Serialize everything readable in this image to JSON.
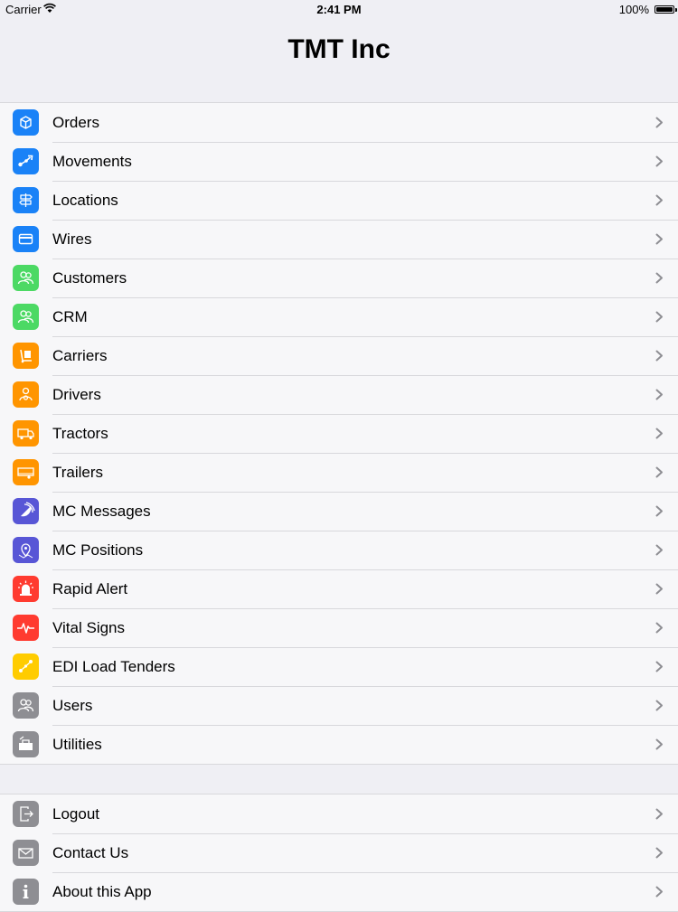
{
  "status": {
    "carrier": "Carrier",
    "time": "2:41 PM",
    "battery": "100%"
  },
  "nav": {
    "title": "TMT Inc"
  },
  "menu": [
    {
      "label": "Orders",
      "icon": "box-icon",
      "color": "#1a82f7"
    },
    {
      "label": "Movements",
      "icon": "route-icon",
      "color": "#1a82f7"
    },
    {
      "label": "Locations",
      "icon": "signpost-icon",
      "color": "#1a82f7"
    },
    {
      "label": "Wires",
      "icon": "card-icon",
      "color": "#1a82f7"
    },
    {
      "label": "Customers",
      "icon": "people-icon",
      "color": "#4cd964"
    },
    {
      "label": "CRM",
      "icon": "people-icon",
      "color": "#4cd964"
    },
    {
      "label": "Carriers",
      "icon": "dolly-icon",
      "color": "#ff9500"
    },
    {
      "label": "Drivers",
      "icon": "driver-icon",
      "color": "#ff9500"
    },
    {
      "label": "Tractors",
      "icon": "truck-icon",
      "color": "#ff9500"
    },
    {
      "label": "Trailers",
      "icon": "trailer-icon",
      "color": "#ff9500"
    },
    {
      "label": "MC Messages",
      "icon": "satellite-icon",
      "color": "#5856d6"
    },
    {
      "label": "MC Positions",
      "icon": "map-pin-icon",
      "color": "#5856d6"
    },
    {
      "label": "Rapid Alert",
      "icon": "alarm-icon",
      "color": "#ff3b30"
    },
    {
      "label": "Vital Signs",
      "icon": "pulse-icon",
      "color": "#ff3b30"
    },
    {
      "label": "EDI Load Tenders",
      "icon": "connect-icon",
      "color": "#ffcc00"
    },
    {
      "label": "Users",
      "icon": "people-icon",
      "color": "#8e8e93"
    },
    {
      "label": "Utilities",
      "icon": "toolbox-icon",
      "color": "#8e8e93"
    }
  ],
  "footer_menu": [
    {
      "label": "Logout",
      "icon": "logout-icon",
      "color": "#8e8e93"
    },
    {
      "label": "Contact Us",
      "icon": "envelope-icon",
      "color": "#8e8e93"
    },
    {
      "label": "About this App",
      "icon": "info-icon",
      "color": "#8e8e93"
    }
  ]
}
